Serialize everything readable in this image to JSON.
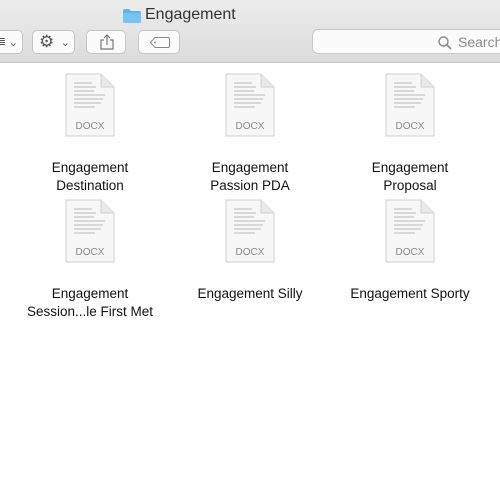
{
  "window": {
    "title": "Engagement"
  },
  "toolbar": {
    "view_label": "",
    "search_placeholder": "Search"
  },
  "files": [
    {
      "line1": "Engagement",
      "line2": "Destination",
      "type": "DOCX"
    },
    {
      "line1": "Engagement",
      "line2": "Passion PDA",
      "type": "DOCX"
    },
    {
      "line1": "Engagement",
      "line2": "Proposal",
      "type": "DOCX"
    },
    {
      "line1": "Engagement",
      "line2": "Session...le First Met",
      "type": "DOCX"
    },
    {
      "line1": "Engagement Silly",
      "line2": "",
      "type": "DOCX"
    },
    {
      "line1": "Engagement Sporty",
      "line2": "",
      "type": "DOCX"
    }
  ],
  "colors": {
    "folder": "#5fb3ec",
    "toolbar": "#e3e3e3"
  }
}
